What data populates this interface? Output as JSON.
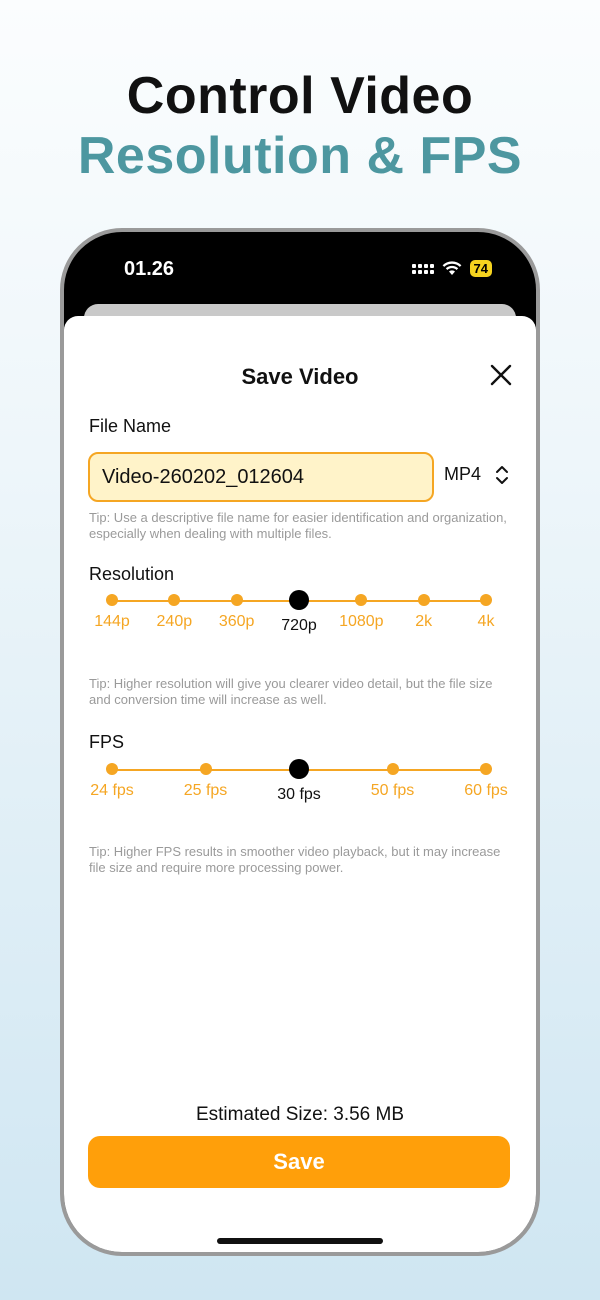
{
  "headline": {
    "line1": "Control Video",
    "line2": "Resolution & FPS"
  },
  "status_bar": {
    "time": "01.26",
    "battery": "74"
  },
  "sheet": {
    "title": "Save Video",
    "file_name_label": "File Name",
    "file_name_value": "Video-260202_012604",
    "format": "MP4",
    "file_tip": "Tip: Use a descriptive file name for easier identification and organization, especially when dealing with multiple files.",
    "resolution_label": "Resolution",
    "resolution_options": [
      "144p",
      "240p",
      "360p",
      "720p",
      "1080p",
      "2k",
      "4k"
    ],
    "resolution_selected": 3,
    "resolution_tip": "Tip: Higher resolution will give you clearer video detail, but the file size and conversion time will increase as well.",
    "fps_label": "FPS",
    "fps_options": [
      "24 fps",
      "25 fps",
      "30 fps",
      "50 fps",
      "60 fps"
    ],
    "fps_selected": 2,
    "fps_tip": "Tip: Higher FPS results in smoother video playback, but it may increase file size and require more processing power.",
    "estimated_size": "Estimated Size: 3.56 MB",
    "save_label": "Save"
  },
  "colors": {
    "accent": "#ff9f0a",
    "slider": "#f5a623",
    "headline_accent": "#4d97a0",
    "input_bg": "#fff3c9"
  }
}
